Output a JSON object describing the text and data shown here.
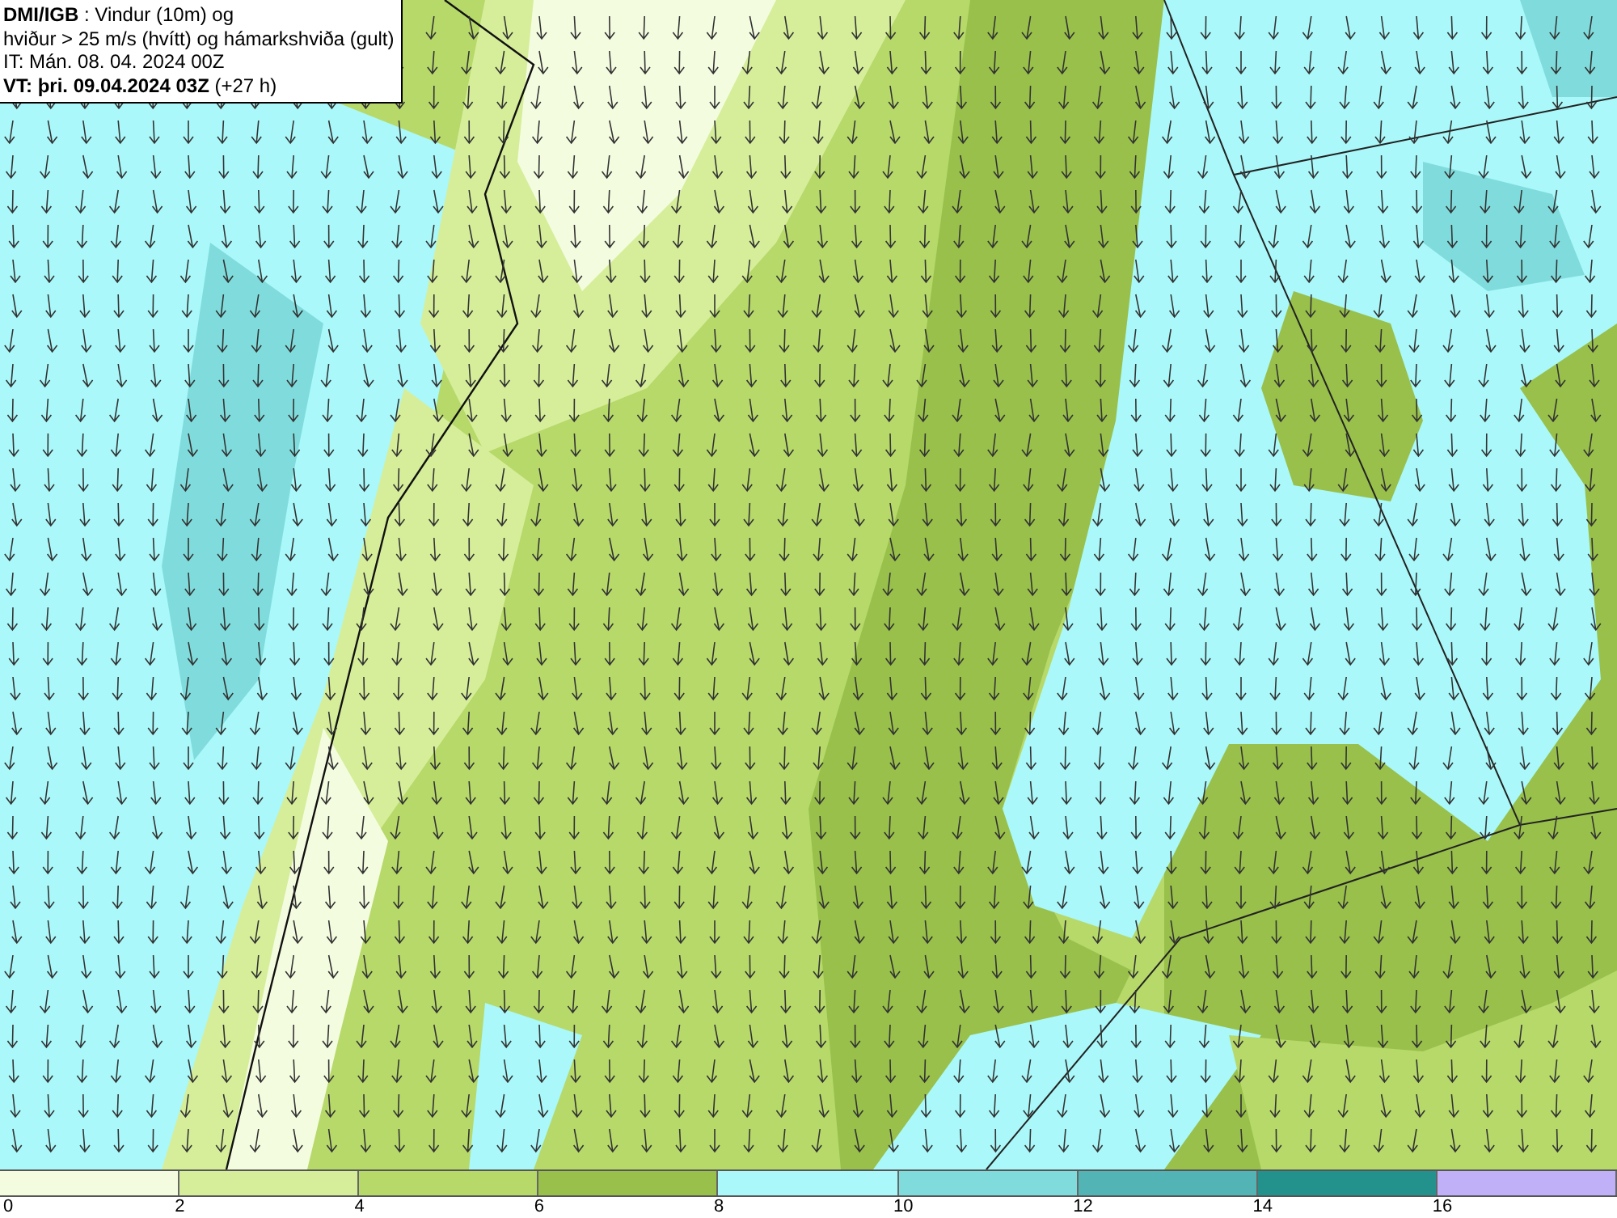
{
  "header": {
    "lines": [
      "**DMI/IGB** : Vindur (10m) og",
      "hviður > 25 m/s (hvítt) og hámarkshviða (gult)",
      "IT: Mán. 08. 04. 2024 00Z",
      "**VT: þri. 09.04.2024 03Z** (+27 h)"
    ]
  },
  "legend": {
    "bins": [
      {
        "color": "#f4fce0"
      },
      {
        "color": "#d6ee9a"
      },
      {
        "color": "#b6d96a"
      },
      {
        "color": "#98c04a"
      },
      {
        "color": "#aaf8fa"
      },
      {
        "color": "#80dcdc"
      },
      {
        "color": "#52b4b4"
      },
      {
        "color": "#24928c"
      },
      {
        "color": "#c0b0f8"
      }
    ],
    "labels": [
      "0",
      "2",
      "4",
      "6",
      "8",
      "10",
      "12",
      "14",
      "16"
    ]
  }
}
